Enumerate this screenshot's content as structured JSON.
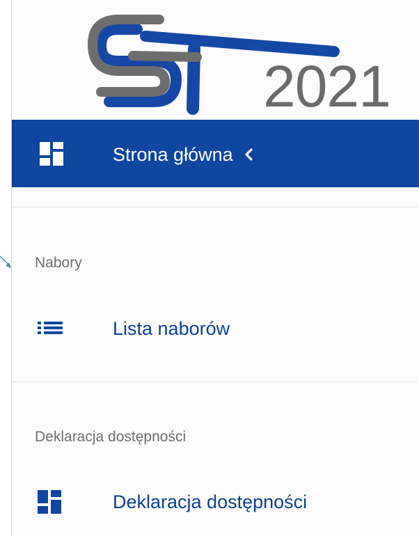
{
  "brand": {
    "logo_letters": "ST",
    "logo_year": "2021",
    "primary_color": "#0e46a0",
    "logo_grey": "#6b6b6b"
  },
  "home": {
    "label": "Strona główna",
    "icon": "dashboard-icon",
    "toggle_icon": "chevron-left-icon"
  },
  "sections": [
    {
      "label": "Nabory",
      "items": [
        {
          "label": "Lista naborów",
          "icon": "list-icon"
        }
      ]
    },
    {
      "label": "Deklaracja dostępności",
      "items": [
        {
          "label": "Deklaracja dostępności",
          "icon": "dashboard-icon"
        }
      ]
    }
  ]
}
